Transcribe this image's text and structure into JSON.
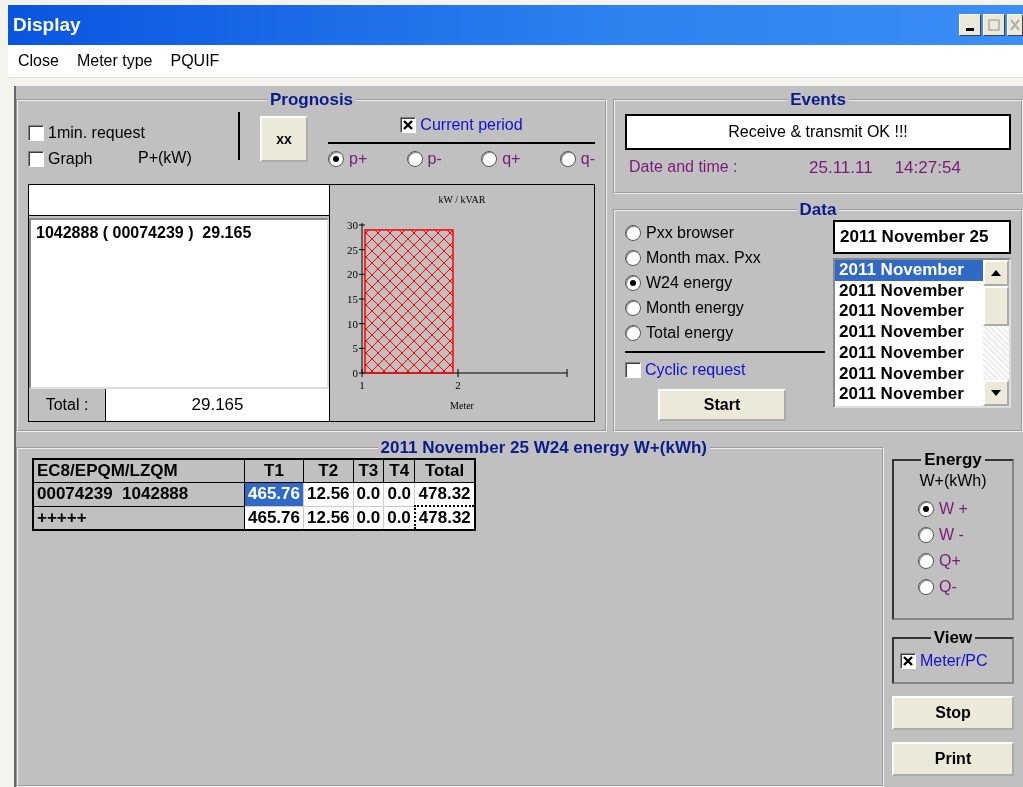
{
  "window": {
    "title": "Display"
  },
  "menu": [
    "Close",
    "Meter type",
    "PQUIF"
  ],
  "prognosis": {
    "title": "Prognosis",
    "options": [
      {
        "label": "1min. request",
        "checked": false
      },
      {
        "label": "Graph",
        "checked": false
      }
    ],
    "unit": "P+(kW)",
    "button": "xx",
    "current_period": {
      "label": "Current period",
      "checked": true
    },
    "modes": [
      {
        "label": "p+",
        "selected": true
      },
      {
        "label": "p-",
        "selected": false
      },
      {
        "label": "q+",
        "selected": false
      },
      {
        "label": "q-",
        "selected": false
      }
    ],
    "list_rows": [
      "1042888 ( 00074239 )  29.165"
    ],
    "total_label": "Total :",
    "total_value": "29.165",
    "chart_data": {
      "type": "bar",
      "title": "kW / kVAR",
      "xlabel": "Meter",
      "categories": [
        "1",
        "2"
      ],
      "values": [
        29,
        null
      ],
      "ylim": [
        0,
        30
      ],
      "yticks": [
        0,
        5,
        10,
        15,
        20,
        25,
        30
      ]
    }
  },
  "events": {
    "title": "Events",
    "message": "Receive & transmit OK !!!",
    "datetime_label": "Date and time :",
    "date": "25.11.11",
    "time": "14:27:54"
  },
  "data": {
    "title": "Data",
    "views": [
      {
        "label": "Pxx browser",
        "selected": false
      },
      {
        "label": "Month max. Pxx",
        "selected": false
      },
      {
        "label": "W24 energy",
        "selected": true
      },
      {
        "label": "Month energy",
        "selected": false
      },
      {
        "label": "Total energy",
        "selected": false
      }
    ],
    "cyclic": {
      "label": "Cyclic request",
      "checked": false
    },
    "start_button": "Start",
    "date_field": "2011 November 25",
    "dates": [
      {
        "label": "2011 November",
        "selected": true
      },
      {
        "label": "2011 November",
        "selected": false
      },
      {
        "label": "2011 November",
        "selected": false
      },
      {
        "label": "2011 November",
        "selected": false
      },
      {
        "label": "2011 November",
        "selected": false
      },
      {
        "label": "2011 November",
        "selected": false
      },
      {
        "label": "2011 November",
        "selected": false
      }
    ]
  },
  "results": {
    "title": "2011 November 25 W24 energy  W+(kWh)",
    "columns": [
      "EC8/EPQM/LZQM",
      "T1",
      "T2",
      "T3",
      "T4",
      "Total"
    ],
    "rows": [
      {
        "cells": [
          {
            "text": "00074239  1042888",
            "selected": false,
            "focused": false
          },
          {
            "text": "465.76",
            "selected": true,
            "focused": false
          },
          {
            "text": "12.56",
            "selected": false,
            "focused": false
          },
          {
            "text": "0.0",
            "selected": false,
            "focused": false
          },
          {
            "text": "0.0",
            "selected": false,
            "focused": false
          },
          {
            "text": "478.32",
            "selected": false,
            "focused": false
          }
        ]
      },
      {
        "cells": [
          {
            "text": "+++++",
            "selected": false,
            "focused": false
          },
          {
            "text": "465.76",
            "selected": false,
            "focused": false
          },
          {
            "text": "12.56",
            "selected": false,
            "focused": false
          },
          {
            "text": "0.0",
            "selected": false,
            "focused": false
          },
          {
            "text": "0.0",
            "selected": false,
            "focused": false
          },
          {
            "text": "478.32",
            "selected": false,
            "focused": true
          }
        ]
      }
    ]
  },
  "energy": {
    "title": "Energy",
    "unit": "W+(kWh)",
    "options": [
      {
        "label": "W +",
        "selected": true
      },
      {
        "label": "W -",
        "selected": false
      },
      {
        "label": "Q+",
        "selected": false
      },
      {
        "label": "Q-",
        "selected": false
      }
    ]
  },
  "view": {
    "title": "View",
    "option": {
      "label": "Meter/PC",
      "checked": true
    }
  },
  "buttons": [
    "Stop",
    "Print"
  ]
}
